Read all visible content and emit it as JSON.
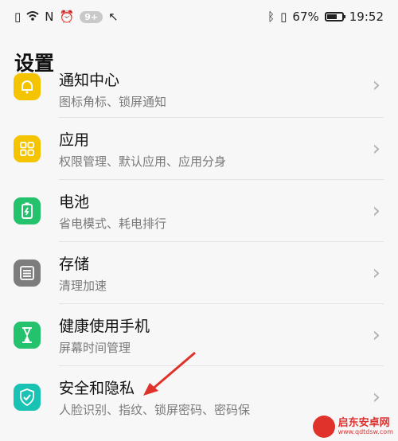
{
  "status_bar": {
    "notification_badge": "9+",
    "battery_percent": "67%",
    "battery_level": 0.67,
    "time": "19:52",
    "icons": [
      "sim-icon",
      "wifi-icon",
      "nfc-icon",
      "alarm-icon",
      "missed-call-icon",
      "bluetooth-icon",
      "vibrate-icon",
      "battery-icon"
    ]
  },
  "page": {
    "title": "设置"
  },
  "settings": {
    "items": [
      {
        "title": "通知中心",
        "subtitle": "图标角标、锁屏通知",
        "icon": "bell-icon",
        "color": "#f5c400"
      },
      {
        "title": "应用",
        "subtitle": "权限管理、默认应用、应用分身",
        "icon": "apps-grid-icon",
        "color": "#f5c400"
      },
      {
        "title": "电池",
        "subtitle": "省电模式、耗电排行",
        "icon": "battery-icon",
        "color": "#25c26e"
      },
      {
        "title": "存储",
        "subtitle": "清理加速",
        "icon": "storage-icon",
        "color": "#7d7d7d"
      },
      {
        "title": "健康使用手机",
        "subtitle": "屏幕时间管理",
        "icon": "hourglass-icon",
        "color": "#25c26e"
      },
      {
        "title": "安全和隐私",
        "subtitle": "人脸识别、指纹、锁屏密码、密码保",
        "icon": "shield-check-icon",
        "color": "#19c2b3"
      }
    ]
  },
  "watermark": {
    "cn": "启东安卓网",
    "en": "www.qdtdsw.com"
  },
  "colors": {
    "accent_red": "#e0322b"
  }
}
